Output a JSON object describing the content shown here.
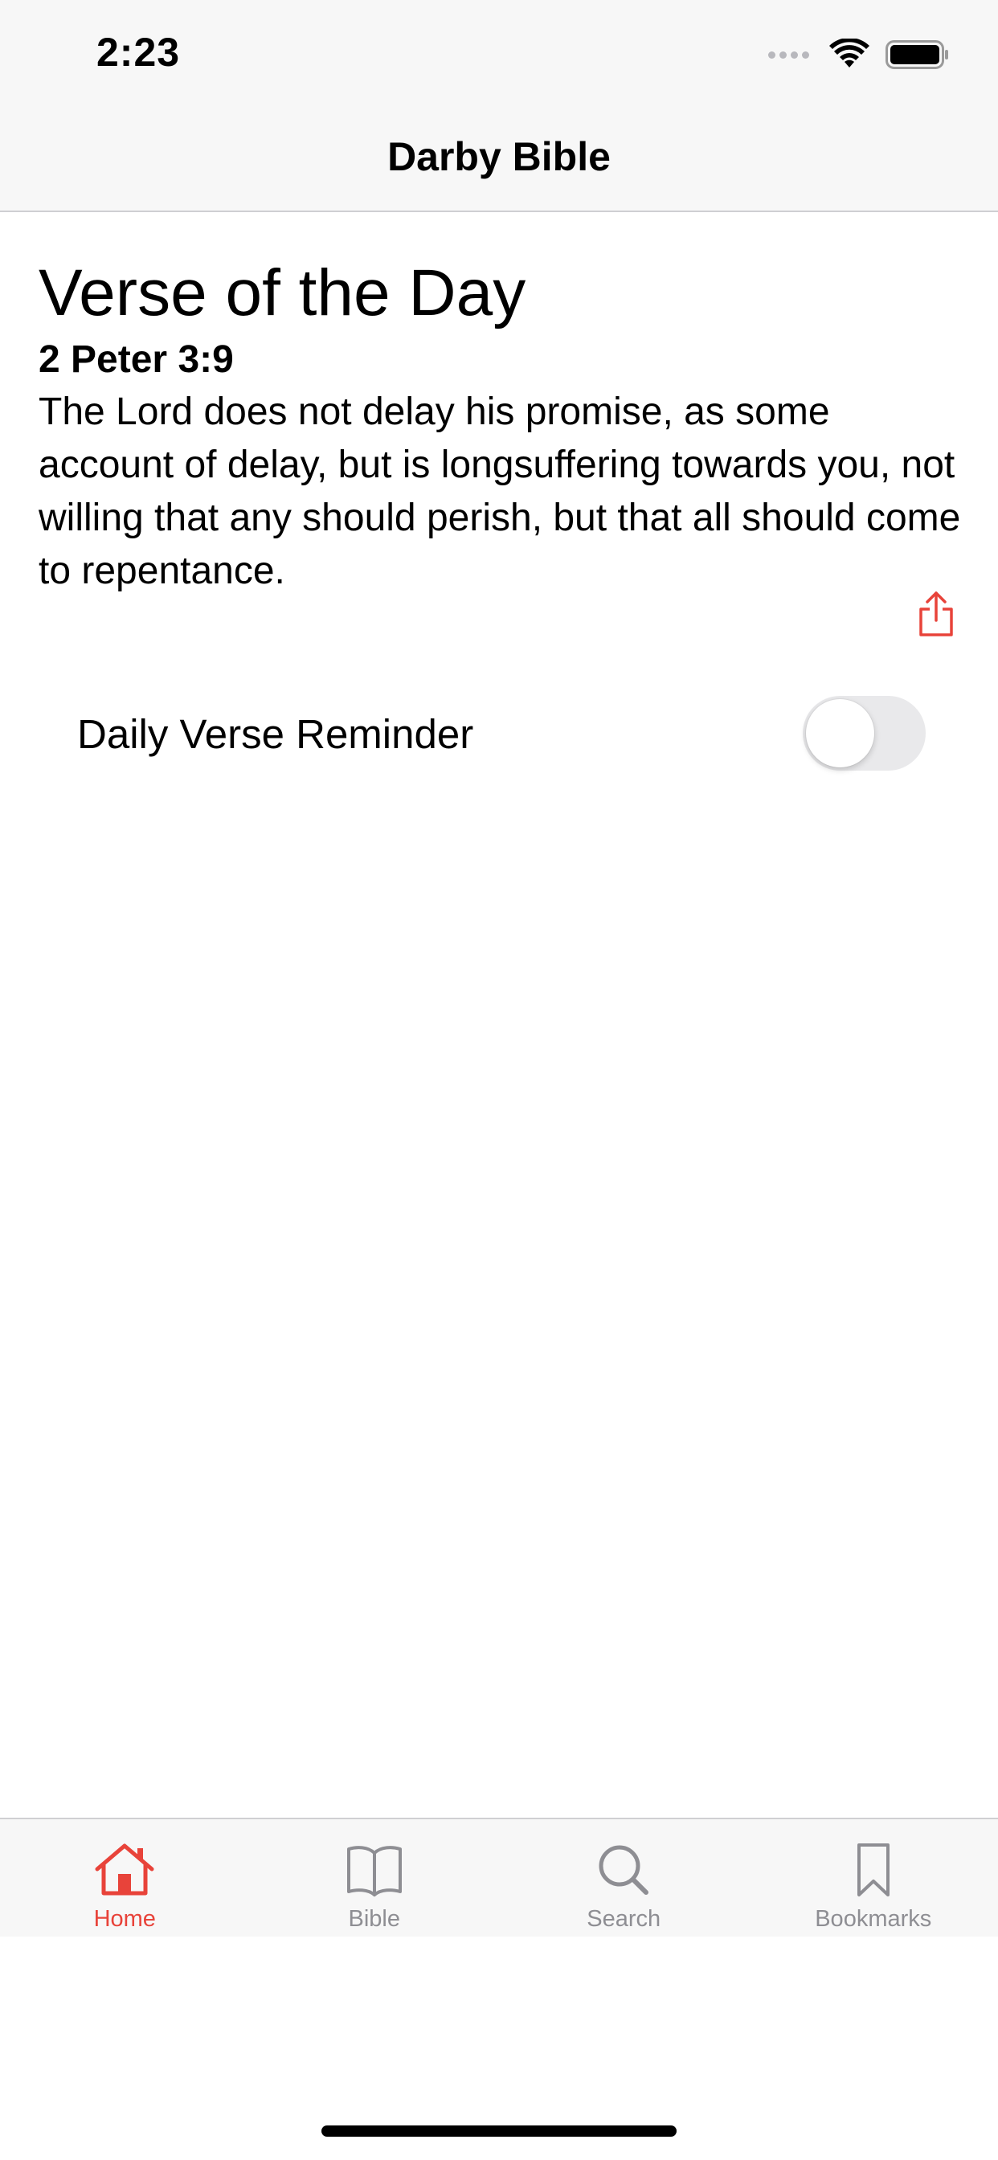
{
  "status_bar": {
    "time": "2:23"
  },
  "nav": {
    "title": "Darby Bible"
  },
  "verse_of_day": {
    "heading": "Verse of the Day",
    "reference": "2 Peter 3:9",
    "text": "The Lord does not delay his promise, as some account of delay, but is longsuffering towards you, not willing that any should perish, but that all should come to repentance.",
    "share_icon": "share-icon"
  },
  "reminder": {
    "label": "Daily Verse Reminder",
    "enabled": false
  },
  "tab_bar": {
    "items": [
      {
        "label": "Home",
        "icon": "house-icon",
        "active": true
      },
      {
        "label": "Bible",
        "icon": "book-icon",
        "active": false
      },
      {
        "label": "Search",
        "icon": "magnifier-icon",
        "active": false
      },
      {
        "label": "Bookmarks",
        "icon": "bookmark-icon",
        "active": false
      }
    ]
  },
  "colors": {
    "accent": "#e8433a",
    "inactive": "#8e8e93",
    "bar_background": "#f7f7f7",
    "toggle_off": "#e9e9eb"
  }
}
